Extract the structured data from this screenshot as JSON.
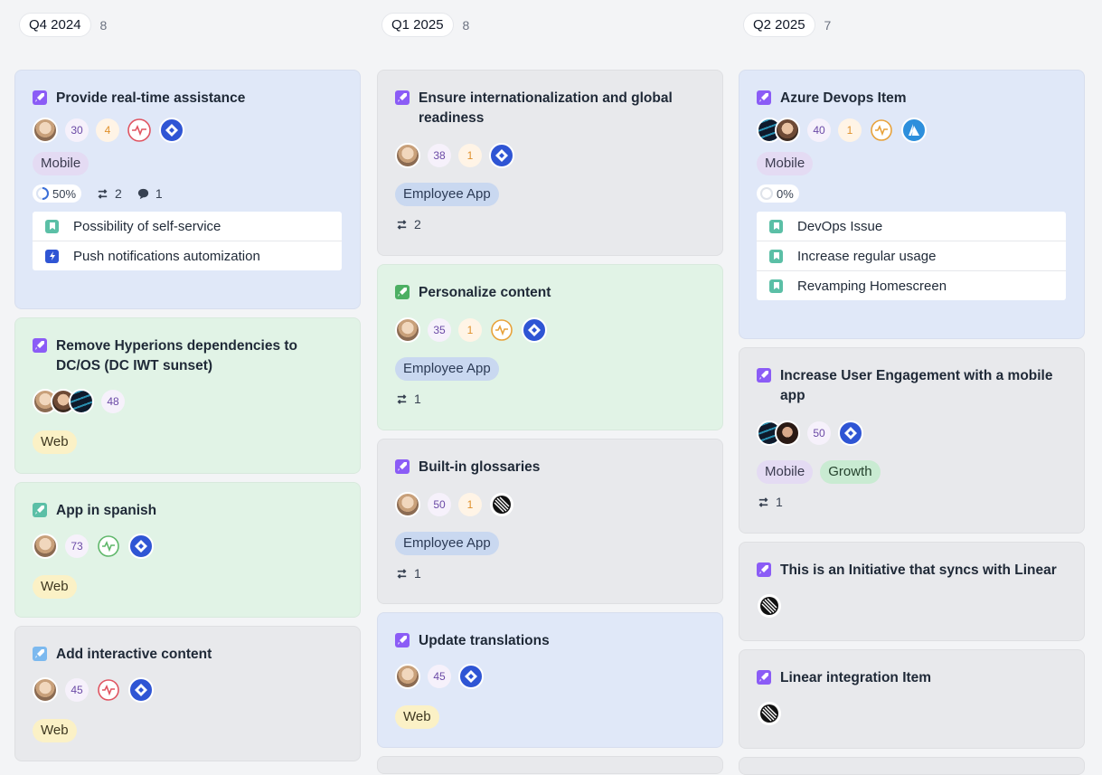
{
  "columns": [
    {
      "label": "Q4 2024",
      "count": "8",
      "cards": [
        {
          "title": "Provide real-time assistance",
          "score": "30",
          "votes": "4",
          "progress": "50%",
          "links": "2",
          "comments": "1",
          "tag": "Mobile",
          "subitems": [
            "Possibility of self-service",
            "Push notifications automization"
          ]
        },
        {
          "title": "Remove Hyperions dependencies to DC/OS (DC IWT sunset)",
          "score": "48",
          "tag": "Web"
        },
        {
          "title": "App in spanish",
          "score": "73",
          "tag": "Web"
        },
        {
          "title": "Add interactive content",
          "score": "45",
          "tag": "Web"
        }
      ]
    },
    {
      "label": "Q1 2025",
      "count": "8",
      "cards": [
        {
          "title": "Ensure internationalization and global readiness",
          "score": "38",
          "votes": "1",
          "tag": "Employee App",
          "links": "2"
        },
        {
          "title": "Personalize content",
          "score": "35",
          "votes": "1",
          "tag": "Employee App",
          "links": "1"
        },
        {
          "title": "Built-in glossaries",
          "score": "50",
          "votes": "1",
          "tag": "Employee App",
          "links": "1"
        },
        {
          "title": "Update translations",
          "score": "45",
          "tag": "Web"
        }
      ]
    },
    {
      "label": "Q2 2025",
      "count": "7",
      "cards": [
        {
          "title": "Azure Devops Item",
          "score": "40",
          "votes": "1",
          "tag": "Mobile",
          "progress": "0%",
          "subitems": [
            "DevOps Issue",
            "Increase regular usage",
            "Revamping Homescreen"
          ]
        },
        {
          "title": "Increase User Engagement with a mobile app",
          "score": "50",
          "tags": [
            "Mobile",
            "Growth"
          ],
          "links": "1"
        },
        {
          "title": "This is an Initiative that syncs with Linear"
        },
        {
          "title": "Linear integration Item"
        }
      ]
    }
  ],
  "colors": {
    "accent_purple": "#8b5cf6",
    "teal": "#5bbfa6",
    "jira_blue": "#2f55d4",
    "azure_blue": "#2d8fdc"
  }
}
